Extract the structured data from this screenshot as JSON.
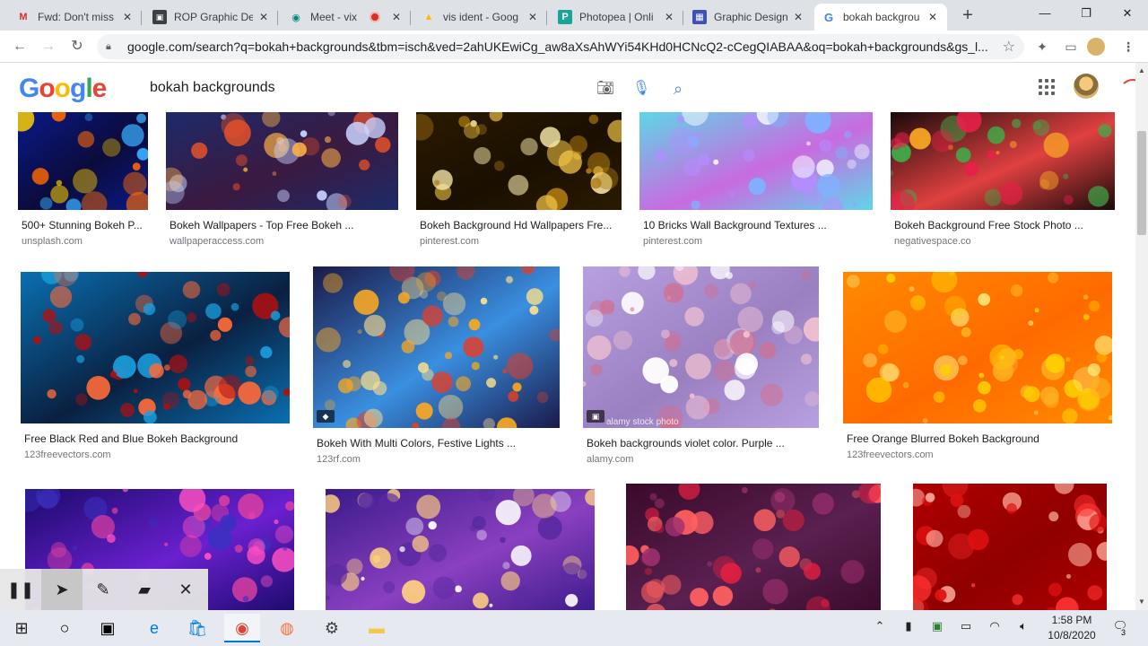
{
  "browser": {
    "tabs": [
      {
        "title": "Fwd: Don't miss",
        "icon": "gmail-icon",
        "glyph": "M",
        "color": "#d93025"
      },
      {
        "title": "ROP Graphic De",
        "icon": "classroom-icon",
        "glyph": "▣",
        "color": "#3c4043"
      },
      {
        "title": "Meet - vix",
        "icon": "meet-icon",
        "glyph": "◉",
        "color": "#00897b"
      },
      {
        "title": "vis ident - Goog",
        "icon": "drive-icon",
        "glyph": "▲",
        "color": "#fbbc04"
      },
      {
        "title": "Photopea | Onli",
        "icon": "photopea-icon",
        "glyph": "P",
        "color": "#18a497"
      },
      {
        "title": "Graphic Design",
        "icon": "calendar-icon",
        "glyph": "▦",
        "color": "#3f51b5"
      },
      {
        "title": "bokah backgrou",
        "icon": "google-icon",
        "glyph": "G",
        "color": "#4285f4"
      }
    ],
    "url": "google.com/search?q=bokah+backgrounds&tbm=isch&ved=2ahUKEwiCg_aw8aXsAhWYi54KHd0HCNcQ2-cCegQIABAA&oq=bokah+backgrounds&gs_l..."
  },
  "google": {
    "logo_letters": [
      {
        "ch": "G",
        "color": "#4285f4"
      },
      {
        "ch": "o",
        "color": "#ea4335"
      },
      {
        "ch": "o",
        "color": "#fbbc05"
      },
      {
        "ch": "g",
        "color": "#4285f4"
      },
      {
        "ch": "l",
        "color": "#34a853"
      },
      {
        "ch": "e",
        "color": "#ea4335"
      }
    ],
    "query": "bokah backgrounds"
  },
  "results": [
    {
      "title": "500+ Stunning Bokeh P...",
      "source": "unsplash.com",
      "palette": [
        "#0a1a8a",
        "#ff6a00",
        "#3ab0ff",
        "#ffd200",
        "#0b0b3a"
      ]
    },
    {
      "title": "Bokeh Wallpapers - Top Free Bokeh ...",
      "source": "wallpaperaccess.com",
      "palette": [
        "#1d2a6a",
        "#e0502a",
        "#c7d3ff",
        "#ffb347",
        "#3a1a40"
      ]
    },
    {
      "title": "Bokeh Background Hd Wallpapers Fre...",
      "source": "pinterest.com",
      "palette": [
        "#2a1a00",
        "#f7c948",
        "#b07a10",
        "#fff2b0",
        "#1a0f00"
      ]
    },
    {
      "title": "10 Bricks Wall Background Textures ...",
      "source": "pinterest.com",
      "palette": [
        "#5fd6e8",
        "#b58cff",
        "#ffffff",
        "#7fb2ff",
        "#c86be0"
      ]
    },
    {
      "title": "Bokeh Background Free Stock Photo ...",
      "source": "negativespace.co",
      "palette": [
        "#1a0a0a",
        "#e8204a",
        "#3fae49",
        "#f7a823",
        "#e04040"
      ]
    },
    {
      "title": "Free Black Red and Blue Bokeh Background",
      "source": "123freevectors.com",
      "palette": [
        "#0a6fb0",
        "#1aa0e0",
        "#b01010",
        "#ff6a3a",
        "#0a2040"
      ]
    },
    {
      "title": "Bokeh With Multi Colors, Festive Lights ...",
      "source": "123rf.com",
      "palette": [
        "#1a1a4a",
        "#f7a823",
        "#ffe08a",
        "#e0402a",
        "#3a8fe0"
      ]
    },
    {
      "title": "Bokeh backgrounds violet color. Purple ...",
      "source": "alamy.com",
      "palette": [
        "#b8a0e0",
        "#f0c0d0",
        "#ffffff",
        "#d07090",
        "#9a80c0"
      ]
    },
    {
      "title": "Free Orange Blurred Bokeh Background",
      "source": "123freevectors.com",
      "palette": [
        "#ff8a00",
        "#ffd000",
        "#ffb020",
        "#fff080",
        "#ff6a00"
      ]
    },
    {
      "title": "",
      "source": "",
      "palette": [
        "#1a0a6a",
        "#e040a0",
        "#3a30c0",
        "#ff50c0",
        "#6a20d0"
      ]
    },
    {
      "title": "",
      "source": "",
      "palette": [
        "#3a1a8a",
        "#ffd080",
        "#5a2aa0",
        "#ffffff",
        "#8a40c0"
      ]
    },
    {
      "title": "",
      "source": "",
      "palette": [
        "#3a0a2a",
        "#e02040",
        "#a03070",
        "#ff6060",
        "#5a2050"
      ]
    },
    {
      "title": "",
      "source": "",
      "palette": [
        "#b00000",
        "#ff3030",
        "#e01010",
        "#ffb0a0",
        "#900000"
      ]
    }
  ],
  "alamy_watermark": "alamy stock photo",
  "taskbar": {
    "time": "1:58 PM",
    "date": "10/8/2020",
    "notifications": "3"
  }
}
